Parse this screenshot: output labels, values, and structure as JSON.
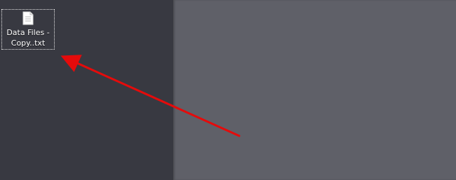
{
  "desktop": {
    "file": {
      "name": "Data Files -\nCopy..txt",
      "icon": "text-file-icon"
    }
  },
  "annotation": {
    "arrow_color": "#e50b0b",
    "icon": "red-arrow-annotation"
  },
  "colors": {
    "desktop_background": "#383941",
    "window_background": "#5f6068"
  }
}
